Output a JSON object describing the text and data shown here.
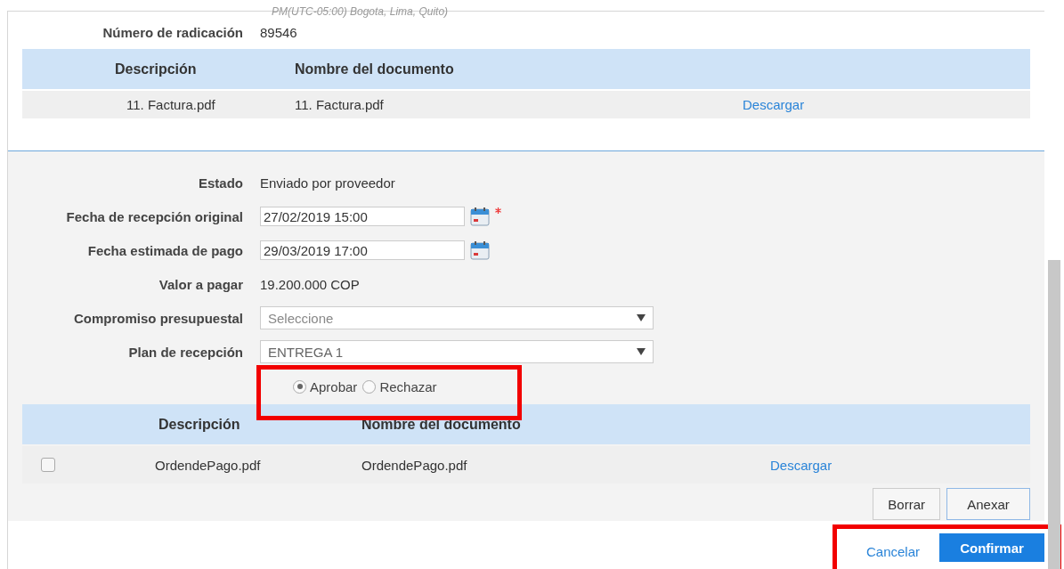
{
  "timezone_note": "PM(UTC-05:00) Bogota, Lima, Quito)",
  "radicacion": {
    "label": "Número de radicación",
    "value": "89546"
  },
  "documents_table": {
    "columns": [
      "Descripción",
      "Nombre del documento"
    ],
    "rows": [
      {
        "description": "11. Factura.pdf",
        "name": "11. Factura.pdf",
        "link": "Descargar"
      }
    ]
  },
  "form": [
    {
      "kind": "text",
      "label": "Estado",
      "value": "Enviado por proveedor"
    },
    {
      "kind": "date",
      "label": "Fecha de recepción original",
      "value": "27/02/2019 15:00",
      "required": true
    },
    {
      "kind": "date",
      "label": "Fecha estimada de pago",
      "value": "29/03/2019 17:00",
      "required": false
    },
    {
      "kind": "text",
      "label": "Valor a pagar",
      "value": "19.200.000 COP"
    },
    {
      "kind": "select",
      "label": "Compromiso presupuestal",
      "placeholder": "Seleccione"
    },
    {
      "kind": "select",
      "label": "Plan de recepción",
      "value": "ENTREGA 1"
    }
  ],
  "decision": [
    {
      "label": "Aprobar",
      "selected": true
    },
    {
      "label": "Rechazar",
      "selected": false
    }
  ],
  "attachments_table": {
    "columns": [
      "Descripción",
      "Nombre del documento"
    ],
    "rows": [
      {
        "checked": false,
        "description": "OrdendePago.pdf",
        "name": "OrdendePago.pdf",
        "link": "Descargar"
      }
    ]
  },
  "attachment_buttons": [
    "Borrar",
    "Anexar"
  ],
  "footer": {
    "cancel": "Cancelar",
    "confirm": "Confirmar"
  }
}
